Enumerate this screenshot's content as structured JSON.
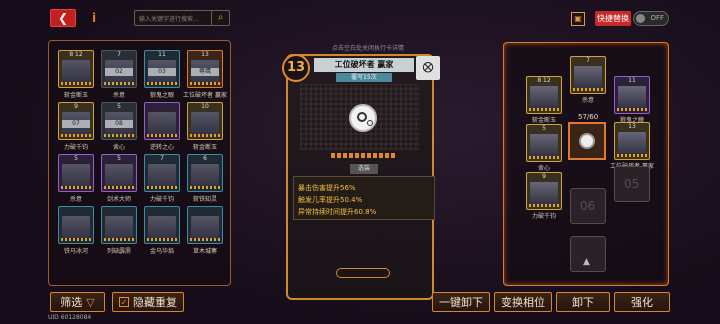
{
  "topbar": {
    "search_placeholder": "输入关键字进行搜索...",
    "quick_replace_label": "快捷替换",
    "toggle_value": "OFF"
  },
  "hint": "点击空白处关闭执行卡详情",
  "detail": {
    "level": "13",
    "name": "工位破坏者 赢家",
    "sub": "覆写15次",
    "state": "选装",
    "stats": [
      "暴击伤害提升56%",
      "触发几率提升50.4%",
      "异常持续时间提升60.8%"
    ]
  },
  "list_cards": [
    {
      "label": "斩金断玉",
      "top": "8 12",
      "num": ""
    },
    {
      "label": "杀意",
      "top": "7",
      "num": "02"
    },
    {
      "label": "狼鬼之眼",
      "top": "11",
      "num": "03"
    },
    {
      "label": "工位破坏者 赢家",
      "top": "13",
      "num": "尊鹰"
    },
    {
      "label": "力破千钧",
      "top": "9",
      "num": "07"
    },
    {
      "label": "舍心",
      "top": "5",
      "num": "08"
    },
    {
      "label": "逆转之心",
      "top": "",
      "num": ""
    },
    {
      "label": "斩金断玉",
      "top": "10",
      "num": ""
    },
    {
      "label": "杀意",
      "top": "5",
      "num": ""
    },
    {
      "label": "剑术大师",
      "top": "5",
      "num": ""
    },
    {
      "label": "力破千钧",
      "top": "7",
      "num": ""
    },
    {
      "label": "斩铁知灵",
      "top": "6",
      "num": ""
    },
    {
      "label": "铁马冰河",
      "top": "",
      "num": ""
    },
    {
      "label": "列缺霹雳",
      "top": "",
      "num": ""
    },
    {
      "label": "金乌华焰",
      "top": "",
      "num": ""
    },
    {
      "label": "草木城寨",
      "top": "",
      "num": ""
    }
  ],
  "equip": {
    "slots": [
      {
        "label": "杀意",
        "top": "7"
      },
      {
        "label": "斩金断玉",
        "top": "8 12"
      },
      {
        "label": "狼鬼之瞳",
        "top": "11"
      },
      {
        "label": "舍心",
        "top": "5"
      },
      {
        "label": "工位破坏者 赢家",
        "top": "13"
      },
      {
        "label": "力破千钧",
        "top": "9"
      }
    ],
    "capacity": "57/60",
    "empty1": "05",
    "empty2": "06"
  },
  "bottom": {
    "filter": "筛选",
    "hide_dup": "隐藏重复",
    "unequip_all": "一键卸下",
    "swap": "变换相位",
    "unequip": "卸下",
    "enhance": "强化"
  },
  "uid": "UID 60128084"
}
